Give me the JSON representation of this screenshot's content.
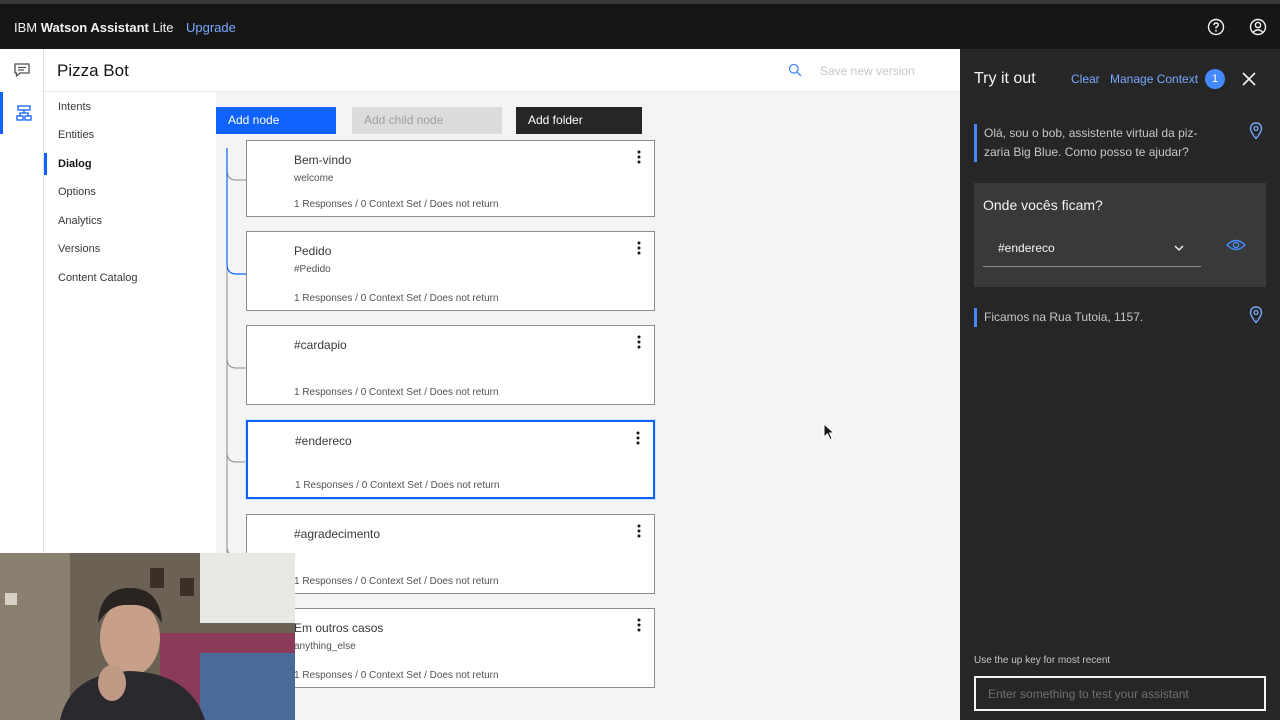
{
  "topbar": {
    "brand_prefix": "IBM",
    "brand_name": "Watson Assistant",
    "brand_plan": "Lite",
    "upgrade_label": "Upgrade"
  },
  "header": {
    "title": "Pizza Bot",
    "save_version_label": "Save new version"
  },
  "sidenav": {
    "items": [
      {
        "label": "Intents"
      },
      {
        "label": "Entities"
      },
      {
        "label": "Dialog"
      },
      {
        "label": "Options"
      },
      {
        "label": "Analytics"
      },
      {
        "label": "Versions"
      },
      {
        "label": "Content Catalog"
      }
    ],
    "active": "Dialog"
  },
  "toolbar": {
    "add_node": "Add node",
    "add_child_node": "Add child node",
    "add_folder": "Add folder"
  },
  "nodes": [
    {
      "title": "Bem-vindo",
      "condition": "welcome",
      "meta": "1 Responses / 0 Context Set / Does not return"
    },
    {
      "title": "Pedido",
      "condition": "#Pedido",
      "meta": "1 Responses / 0 Context Set / Does not return"
    },
    {
      "title": "#cardapio",
      "condition": "",
      "meta": "1 Responses / 0 Context Set / Does not return"
    },
    {
      "title": "#endereco",
      "condition": "",
      "meta": "1 Responses / 0 Context Set / Does not return"
    },
    {
      "title": "#agradecimento",
      "condition": "",
      "meta": "1 Responses / 0 Context Set / Does not return"
    },
    {
      "title": "Em outros casos",
      "condition": "anything_else",
      "meta": "1 Responses / 0 Context Set / Does not return"
    }
  ],
  "tryout": {
    "title": "Try it out",
    "clear_label": "Clear",
    "manage_context_label": "Manage Context",
    "context_count": "1",
    "bot_message_1": "Olá, sou o bob, assistente virtual da piz-zaria Big Blue. Como posso te ajudar?",
    "user_message": "Onde vocês ficam?",
    "detected_intent": "#endereco",
    "bot_message_2": "Ficamos na Rua Tutoia, 1157.",
    "hint": "Use the up key for most recent",
    "input_placeholder": "Enter something to test your assistant"
  },
  "colors": {
    "accent": "#0f62fe",
    "link": "#78a9ff",
    "panel_dark": "#262626",
    "topbar": "#161616"
  },
  "icons": [
    "help-icon",
    "user-profile-icon",
    "chat-icon",
    "dialog-tree-icon",
    "search-icon",
    "overflow-menu-icon",
    "close-icon",
    "location-pin-icon",
    "chevron-down-icon",
    "eye-icon"
  ]
}
